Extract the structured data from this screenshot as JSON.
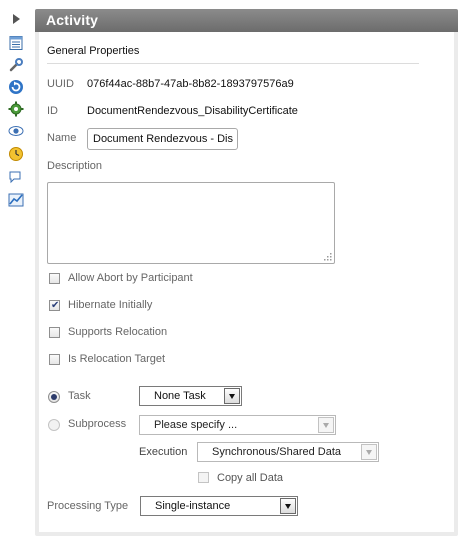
{
  "toolbar": {
    "icons": [
      "collapse-arrow-icon",
      "properties-sheet-icon",
      "wrench-icon",
      "refresh-icon",
      "gear-icon",
      "eye-icon",
      "clock-icon",
      "comments-icon",
      "chart-icon"
    ]
  },
  "panel": {
    "title": "Activity",
    "section_title": "General Properties"
  },
  "fields": {
    "uuid_label": "UUID",
    "uuid_value": "076f44ac-88b7-47ab-8b82-1893797576a9",
    "id_label": "ID",
    "id_value": "DocumentRendezvous_DisabilityCertificate",
    "name_label": "Name",
    "name_value": "Document Rendezvous - Dis",
    "description_label": "Description",
    "description_value": ""
  },
  "checkboxes": [
    {
      "label": "Allow Abort by Participant",
      "checked": false
    },
    {
      "label": "Hibernate Initially",
      "checked": true
    },
    {
      "label": "Supports Relocation",
      "checked": false
    },
    {
      "label": "Is Relocation Target",
      "checked": false
    }
  ],
  "implementation": {
    "task_label": "Task",
    "task_selected": true,
    "task_value": "None Task",
    "subprocess_label": "Subprocess",
    "subprocess_selected": false,
    "subprocess_value": "Please specify ...",
    "execution_label": "Execution",
    "execution_value": "Synchronous/Shared Data",
    "copy_all_data_label": "Copy all Data",
    "copy_all_data_checked": false
  },
  "processing": {
    "label": "Processing Type",
    "value": "Single-instance"
  },
  "colors": {
    "header": "#7a7a7a",
    "panel_bg": "#ebebeb",
    "radio_dot": "#2d3b6b"
  }
}
